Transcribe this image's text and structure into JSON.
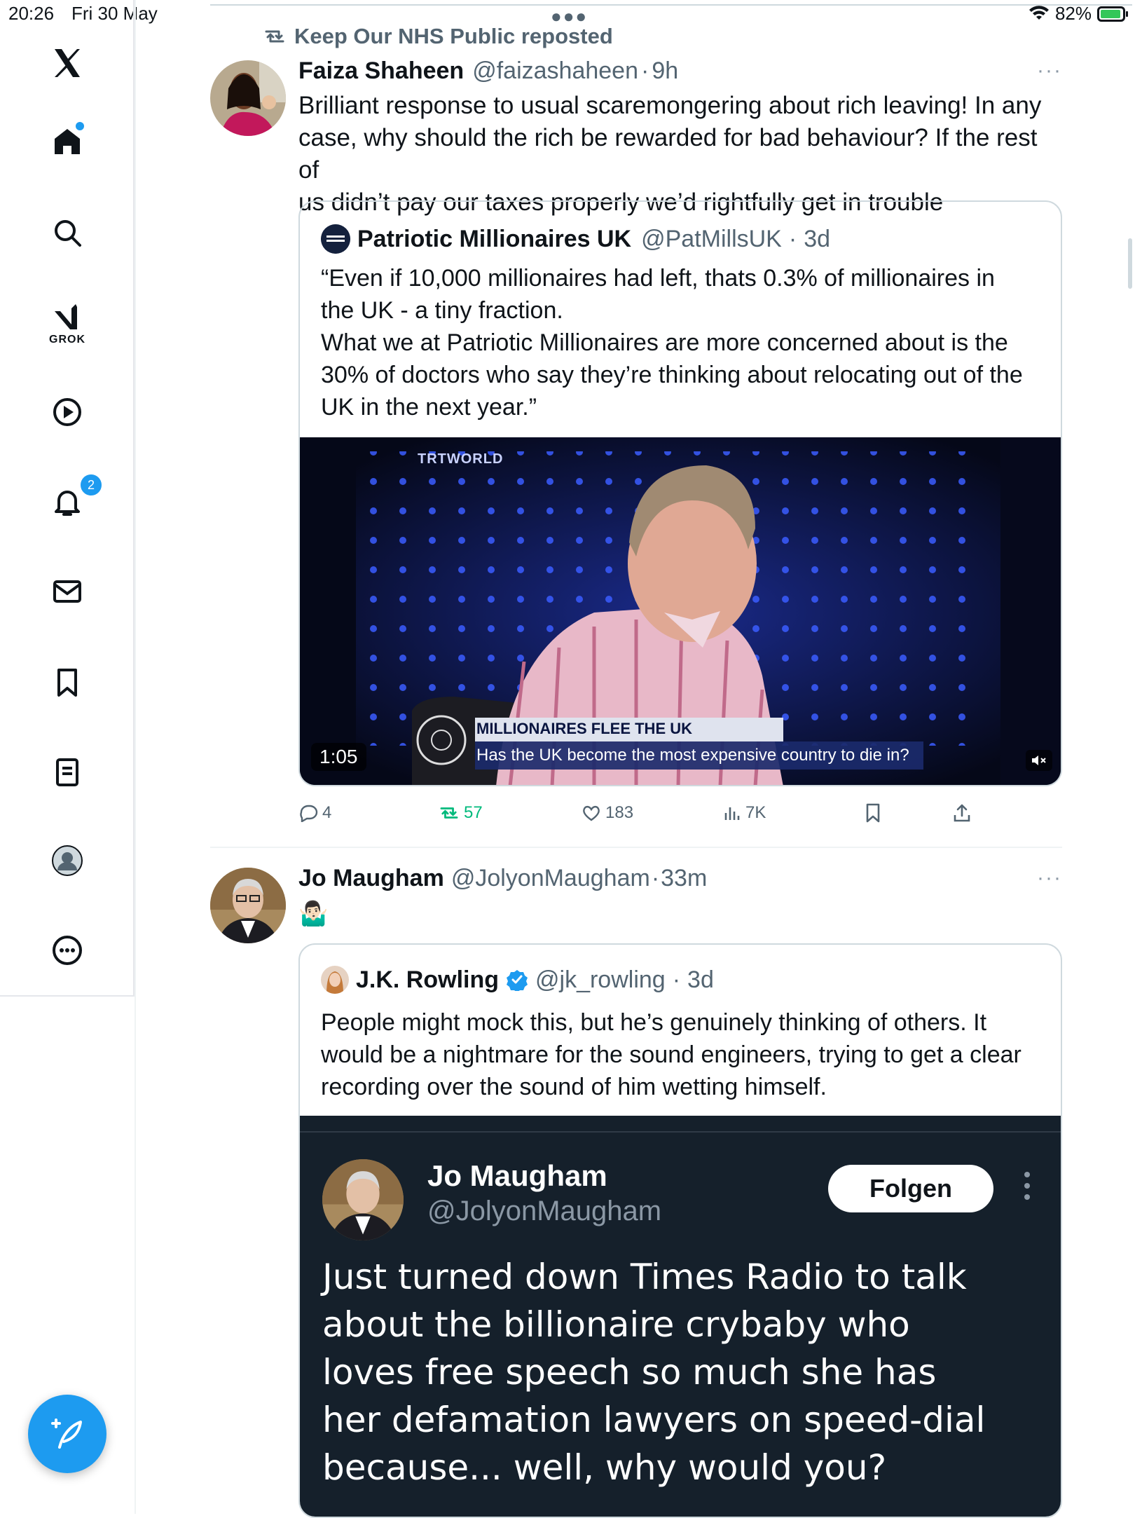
{
  "status": {
    "time": "20:26",
    "date": "Fri 30 May",
    "battery": "82%",
    "battery_level": 0.82
  },
  "sidebar": {
    "grok_label": "GROK",
    "notifications_badge": "2"
  },
  "tweet1": {
    "repost_label": "Keep Our NHS Public reposted",
    "name": "Faiza Shaheen",
    "handle": "@faizashaheen",
    "dot": "·",
    "time": "9h",
    "more": "···",
    "text_lines": [
      "Brilliant response to usual scaremongering about rich leaving! In any",
      "case, why should the rich be rewarded for bad behaviour? If the rest of",
      "us didn’t pay our taxes properly we’d rightfully get in trouble"
    ],
    "quote": {
      "name": "Patriotic Millionaires UK",
      "handle": "@PatMillsUK",
      "dot": "·",
      "time": "3d",
      "text_lines": [
        "“Even if 10,000 millionaires had left, thats 0.3% of millionaires in",
        "the UK - a tiny fraction.",
        "What we at Patriotic Millionaires are more concerned about is the",
        "30% of doctors who say they’re thinking about relocating out of the",
        "UK in the next year.”"
      ],
      "video": {
        "brand": "TRTWORLD",
        "headline": "MILLIONAIRES FLEE THE UK",
        "subline": "Has the UK become the most expensive country to die in?",
        "duration": "1:05"
      }
    },
    "stats": {
      "replies": "4",
      "reposts": "57",
      "likes": "183",
      "views": "7K"
    }
  },
  "tweet2": {
    "name": "Jo Maugham",
    "handle": "@JolyonMaugham",
    "dot": "·",
    "time": "33m",
    "more": "···",
    "emoji": "🤷🏻‍♂️",
    "quote": {
      "name": "J.K. Rowling",
      "handle": "@jk_rowling",
      "dot": "·",
      "time": "3d",
      "text_lines": [
        "People might mock this, but he’s genuinely thinking of others. It",
        "would be a nightmare for the sound engineers, trying to get a clear",
        "recording over the sound of him wetting himself."
      ],
      "screenshot": {
        "name": "Jo Maugham",
        "handle": "@JolyonMaugham",
        "follow_label": "Folgen",
        "text_lines": [
          "Just turned down Times Radio to talk",
          "about the billionaire crybaby who",
          "loves free speech so much she has",
          "her defamation lawyers on speed-dial",
          "because... well, why would you?"
        ]
      }
    }
  },
  "colors": {
    "accent": "#1d9bf0",
    "repost_green": "#00ba7c",
    "muted": "#536471"
  }
}
